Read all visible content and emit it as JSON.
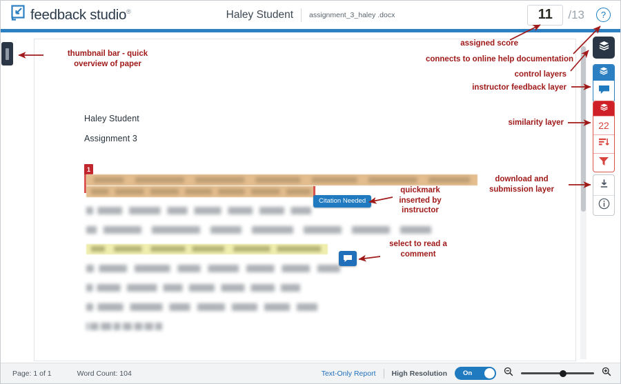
{
  "app": {
    "brand": "feedback studio",
    "brand_reg": "®",
    "logo_icon": "turnitin-arrow-icon"
  },
  "header": {
    "student_name": "Haley Student",
    "document_name": "assignment_3_haley .docx",
    "score": "11",
    "score_total": "/13",
    "help_icon": "question-mark-circle-icon",
    "accent_color": "#2c7fc0"
  },
  "left_rail": {
    "thumbnail_toggle_icon": "thumbnail-bar-toggle-icon"
  },
  "paper": {
    "lines": [
      {
        "text": "Haley Student"
      },
      {
        "text": "Assignment 3"
      }
    ],
    "match_marker": "1",
    "quickmark": {
      "label": "Citation Needed"
    },
    "comment_bubble_icon": "comment-bubble-icon"
  },
  "toolbar": {
    "layers_button": {
      "name": "all-layers-button",
      "icon": "layers-icon"
    },
    "feedback_group": {
      "header_icon": "layers-icon",
      "feedback_icon": "comment-bubble-icon",
      "name": "instructor-feedback-layer"
    },
    "similarity_group": {
      "header_icon": "layers-icon",
      "similarity_score": "22",
      "match_overview_icon": "match-overview-icon",
      "filter_icon": "filter-funnel-icon",
      "name": "similarity-layer"
    },
    "submission_group": {
      "download_icon": "download-arrow-icon",
      "info_icon": "info-circle-icon",
      "name": "download-and-submission-layer"
    }
  },
  "statusbar": {
    "page": "Page: 1 of 1",
    "word_count": "Word Count: 104",
    "text_only_report": "Text-Only Report",
    "high_resolution_label": "High Resolution",
    "toggle_state": "On",
    "zoom_out_icon": "zoom-out-icon",
    "zoom_in_icon": "zoom-in-icon"
  },
  "annotations": {
    "color": "#a01a1a",
    "items": [
      {
        "id": "thumbnail-bar",
        "text": "thumbnail bar - quick\noverview of paper"
      },
      {
        "id": "assigned-score",
        "text": "assigned score"
      },
      {
        "id": "online-help",
        "text": "connects to online help documentation"
      },
      {
        "id": "control-layers",
        "text": "control layers"
      },
      {
        "id": "instructor-feedback-layer",
        "text": "instructor feedback layer"
      },
      {
        "id": "similarity-layer",
        "text": "similarity layer"
      },
      {
        "id": "download-submission-layer",
        "text": "download and\nsubmission layer"
      },
      {
        "id": "quickmark",
        "text": "quickmark\ninserted by\ninstructor"
      },
      {
        "id": "select-comment",
        "text": "select to read a\ncomment"
      }
    ]
  }
}
